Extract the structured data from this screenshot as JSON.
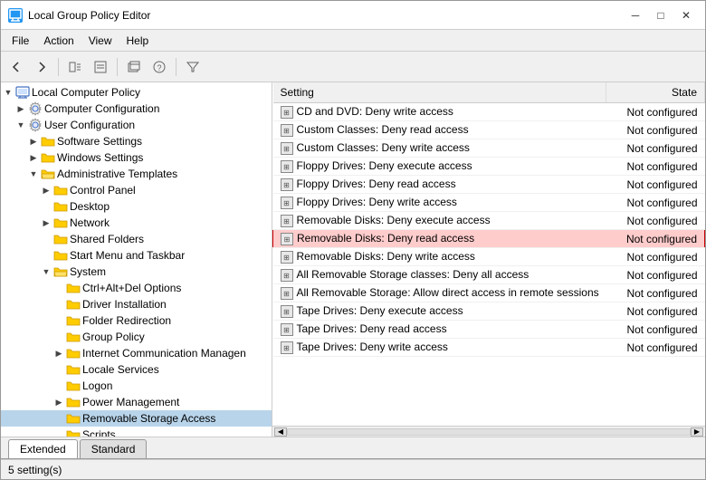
{
  "window": {
    "title": "Local Group Policy Editor",
    "icon": "📋"
  },
  "menu": {
    "items": [
      "File",
      "Action",
      "View",
      "Help"
    ]
  },
  "toolbar": {
    "buttons": [
      "◀",
      "▶",
      "⬆",
      "📋",
      "📋",
      "🔑",
      "📋",
      "🔍"
    ]
  },
  "tree": {
    "items": [
      {
        "id": "root",
        "label": "Local Computer Policy",
        "indent": 0,
        "expand": "▼",
        "icon": "computer",
        "expanded": true
      },
      {
        "id": "cc",
        "label": "Computer Configuration",
        "indent": 1,
        "expand": "▶",
        "icon": "gear",
        "expanded": false
      },
      {
        "id": "uc",
        "label": "User Configuration",
        "indent": 1,
        "expand": "▼",
        "icon": "gear",
        "expanded": true
      },
      {
        "id": "ss",
        "label": "Software Settings",
        "indent": 2,
        "expand": "▶",
        "icon": "folder",
        "expanded": false
      },
      {
        "id": "ws",
        "label": "Windows Settings",
        "indent": 2,
        "expand": "▶",
        "icon": "folder",
        "expanded": false
      },
      {
        "id": "at",
        "label": "Administrative Templates",
        "indent": 2,
        "expand": "▼",
        "icon": "folder-open",
        "expanded": true
      },
      {
        "id": "cp",
        "label": "Control Panel",
        "indent": 3,
        "expand": "▶",
        "icon": "folder",
        "expanded": false
      },
      {
        "id": "dt",
        "label": "Desktop",
        "indent": 3,
        "expand": "  ",
        "icon": "folder",
        "expanded": false
      },
      {
        "id": "nw",
        "label": "Network",
        "indent": 3,
        "expand": "▶",
        "icon": "folder",
        "expanded": false
      },
      {
        "id": "sf",
        "label": "Shared Folders",
        "indent": 3,
        "expand": "  ",
        "icon": "folder",
        "expanded": false
      },
      {
        "id": "stb",
        "label": "Start Menu and Taskbar",
        "indent": 3,
        "expand": "  ",
        "icon": "folder",
        "expanded": false
      },
      {
        "id": "sys",
        "label": "System",
        "indent": 3,
        "expand": "▼",
        "icon": "folder-open",
        "expanded": true
      },
      {
        "id": "cad",
        "label": "Ctrl+Alt+Del Options",
        "indent": 4,
        "expand": "  ",
        "icon": "folder",
        "expanded": false
      },
      {
        "id": "di",
        "label": "Driver Installation",
        "indent": 4,
        "expand": "  ",
        "icon": "folder",
        "expanded": false
      },
      {
        "id": "fr",
        "label": "Folder Redirection",
        "indent": 4,
        "expand": "  ",
        "icon": "folder",
        "expanded": false
      },
      {
        "id": "gp",
        "label": "Group Policy",
        "indent": 4,
        "expand": "  ",
        "icon": "folder",
        "expanded": false
      },
      {
        "id": "icm",
        "label": "Internet Communication Managen",
        "indent": 4,
        "expand": "▶",
        "icon": "folder",
        "expanded": false
      },
      {
        "id": "ls",
        "label": "Locale Services",
        "indent": 4,
        "expand": "  ",
        "icon": "folder",
        "expanded": false
      },
      {
        "id": "lg",
        "label": "Logon",
        "indent": 4,
        "expand": "  ",
        "icon": "folder",
        "expanded": false
      },
      {
        "id": "pm",
        "label": "Power Management",
        "indent": 4,
        "expand": "▶",
        "icon": "folder",
        "expanded": false
      },
      {
        "id": "rsa",
        "label": "Removable Storage Access",
        "indent": 4,
        "expand": "  ",
        "icon": "folder",
        "expanded": false,
        "selected": true
      },
      {
        "id": "sc",
        "label": "Scripts",
        "indent": 4,
        "expand": "  ",
        "icon": "folder",
        "expanded": false
      }
    ]
  },
  "list": {
    "columns": [
      {
        "id": "setting",
        "label": "Setting",
        "width": "75%"
      },
      {
        "id": "state",
        "label": "State",
        "width": "25%"
      }
    ],
    "rows": [
      {
        "setting": "CD and DVD: Deny write access",
        "state": "Not configured",
        "selected": false
      },
      {
        "setting": "Custom Classes: Deny read access",
        "state": "Not configured",
        "selected": false
      },
      {
        "setting": "Custom Classes: Deny write access",
        "state": "Not configured",
        "selected": false
      },
      {
        "setting": "Floppy Drives: Deny execute access",
        "state": "Not configured",
        "selected": false
      },
      {
        "setting": "Floppy Drives: Deny read access",
        "state": "Not configured",
        "selected": false
      },
      {
        "setting": "Floppy Drives: Deny write access",
        "state": "Not configured",
        "selected": false
      },
      {
        "setting": "Removable Disks: Deny execute access",
        "state": "Not configured",
        "selected": false
      },
      {
        "setting": "Removable Disks: Deny read access",
        "state": "Not configured",
        "selected": true
      },
      {
        "setting": "Removable Disks: Deny write access",
        "state": "Not configured",
        "selected": false
      },
      {
        "setting": "All Removable Storage classes: Deny all access",
        "state": "Not configured",
        "selected": false
      },
      {
        "setting": "All Removable Storage: Allow direct access in remote sessions",
        "state": "Not configured",
        "selected": false
      },
      {
        "setting": "Tape Drives: Deny execute access",
        "state": "Not configured",
        "selected": false
      },
      {
        "setting": "Tape Drives: Deny read access",
        "state": "Not configured",
        "selected": false
      },
      {
        "setting": "Tape Drives: Deny write access",
        "state": "Not configured",
        "selected": false
      }
    ]
  },
  "tabs": [
    {
      "label": "Extended",
      "active": true
    },
    {
      "label": "Standard",
      "active": false
    }
  ],
  "status": {
    "text": "5 setting(s)"
  }
}
